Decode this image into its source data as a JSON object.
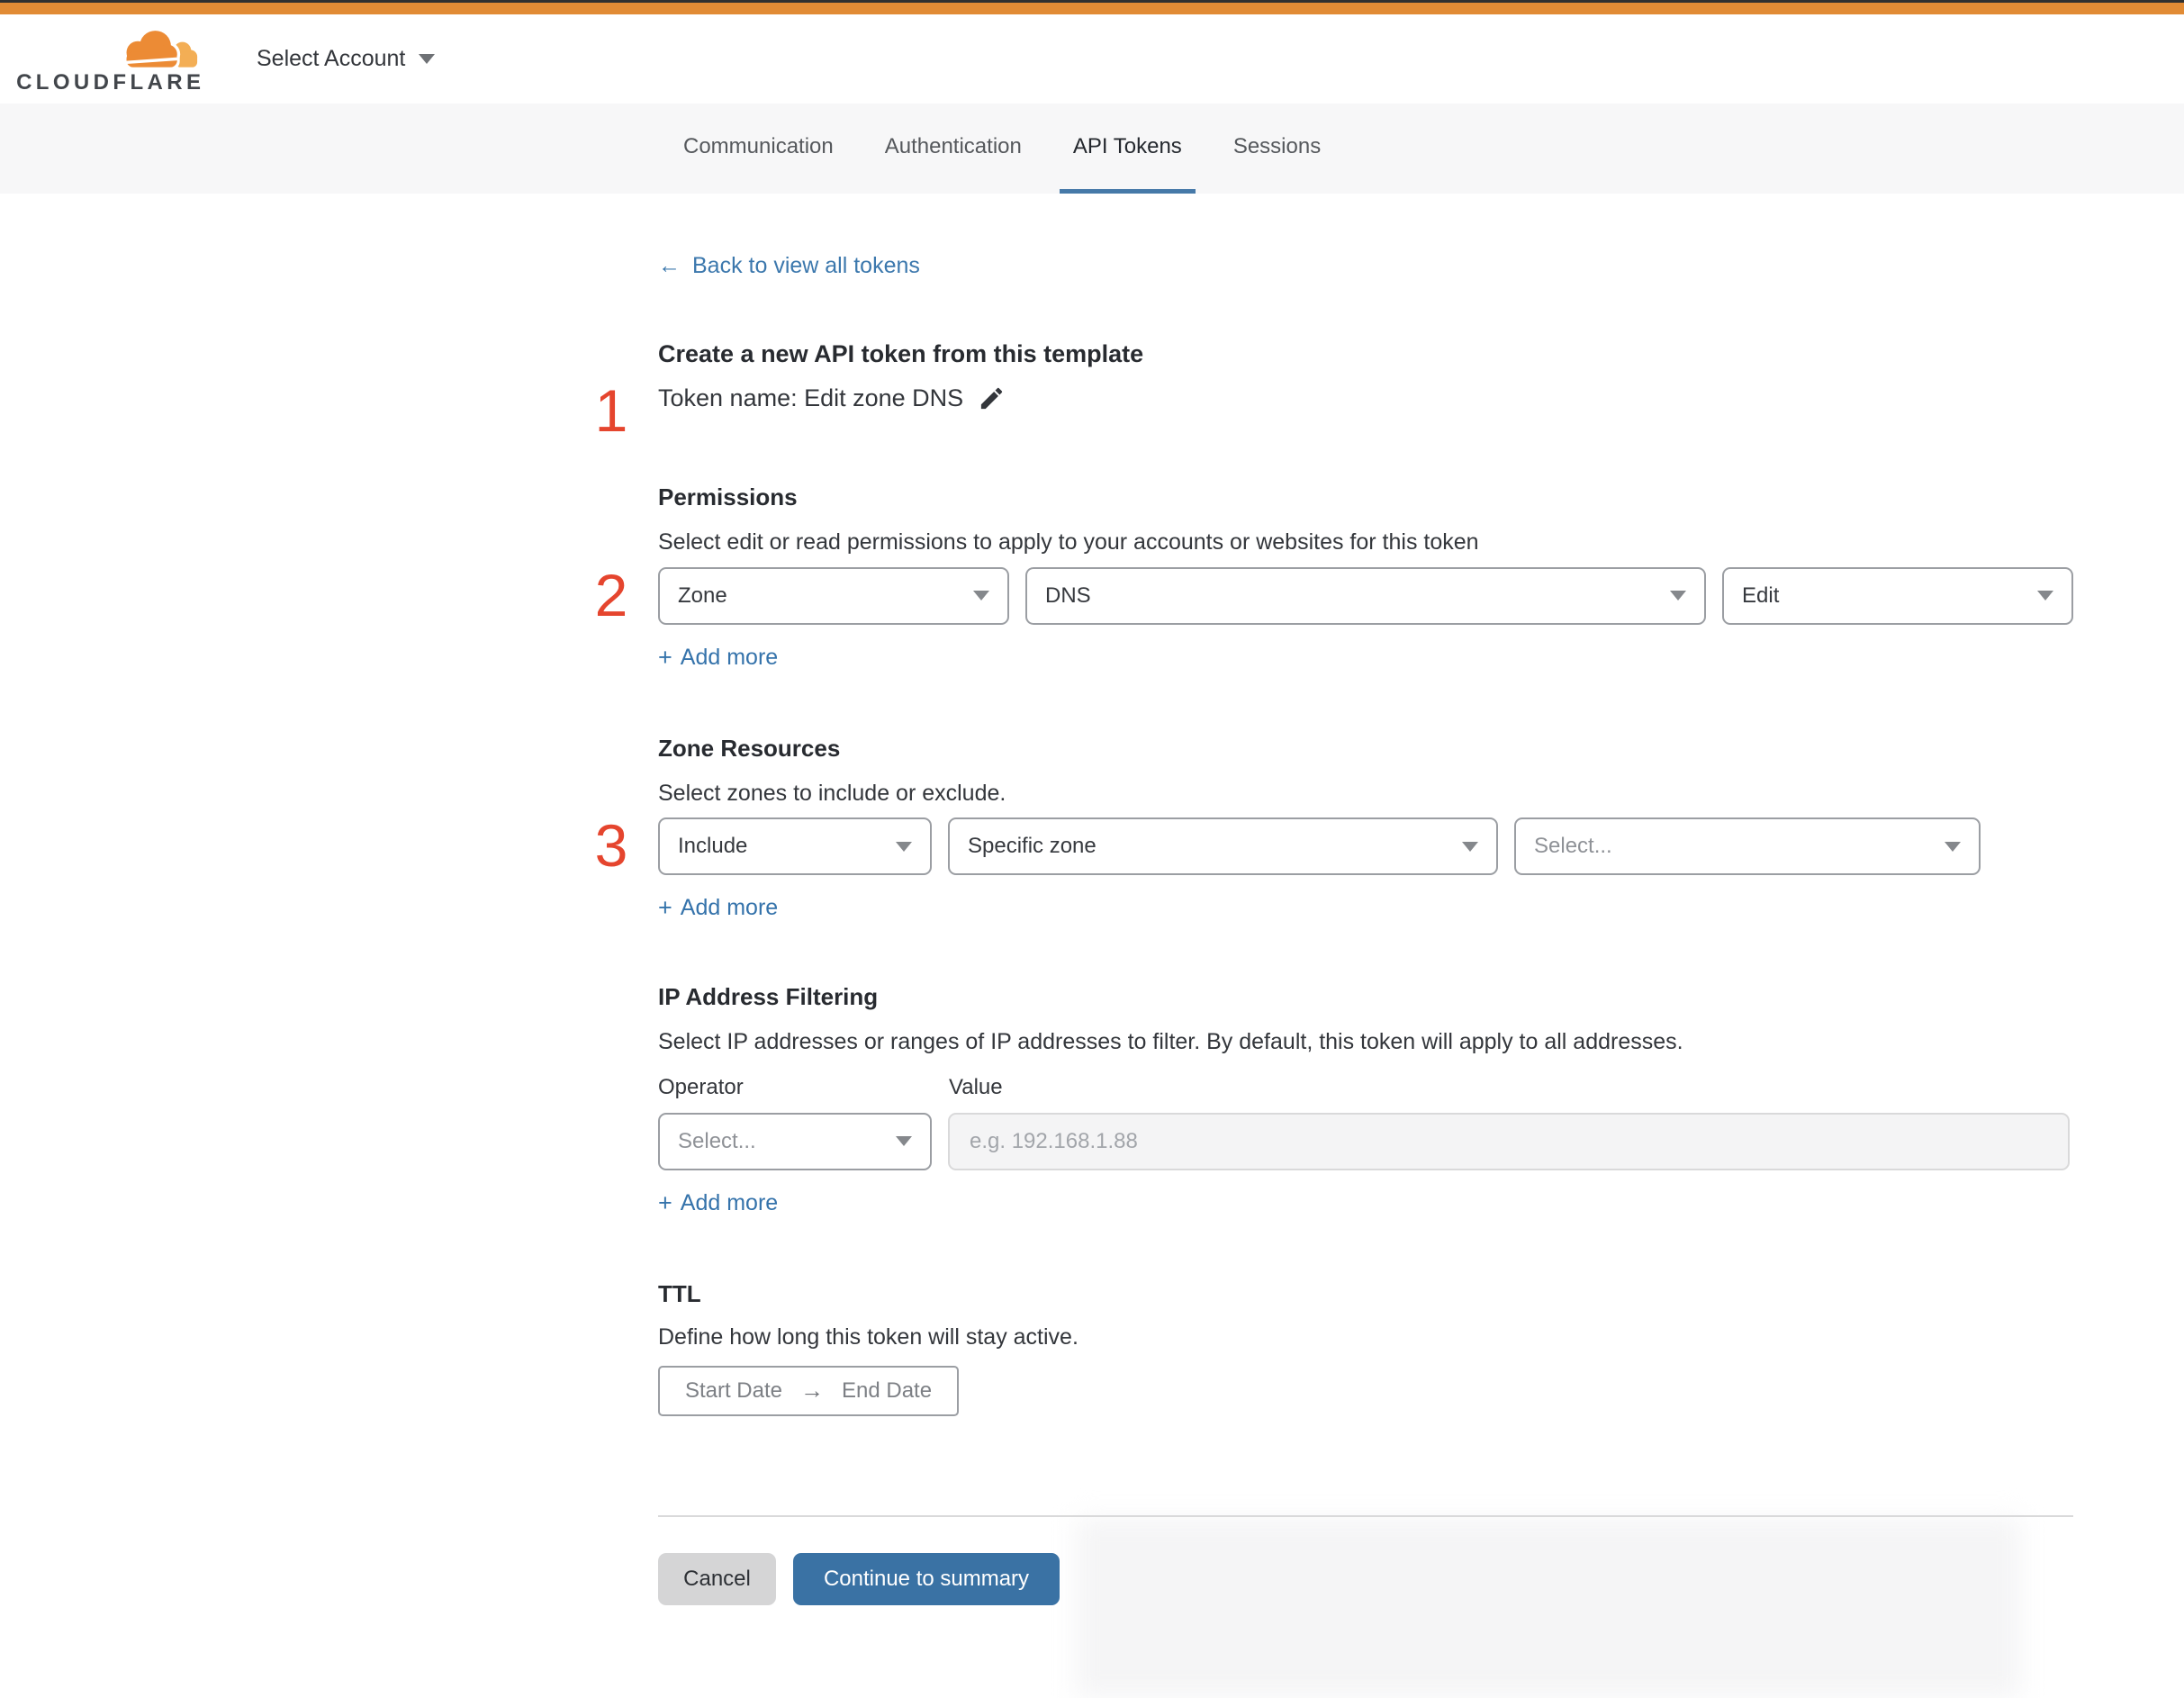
{
  "ui": {
    "plus": "+",
    "add_more": "Add more",
    "back_arrow": "←",
    "arrow_right": "→"
  },
  "header": {
    "logo_text": "CLOUDFLARE",
    "account_selector": "Select Account"
  },
  "tabs": [
    {
      "label": "Communication",
      "active": false
    },
    {
      "label": "Authentication",
      "active": false
    },
    {
      "label": "API Tokens",
      "active": true
    },
    {
      "label": "Sessions",
      "active": false
    }
  ],
  "page": {
    "back_link": "Back to view all tokens",
    "title": "Create a new API token from this template",
    "token_name": "Token name: Edit zone DNS"
  },
  "annotations": {
    "one": "1",
    "two": "2",
    "three": "3"
  },
  "permissions": {
    "title": "Permissions",
    "description": "Select edit or read permissions to apply to your accounts or websites for this token",
    "scope_value": "Zone",
    "resource_value": "DNS",
    "access_value": "Edit"
  },
  "zone_resources": {
    "title": "Zone Resources",
    "description": "Select zones to include or exclude.",
    "mode_value": "Include",
    "type_value": "Specific zone",
    "zone_placeholder": "Select..."
  },
  "ip_filtering": {
    "title": "IP Address Filtering",
    "description": "Select IP addresses or ranges of IP addresses to filter. By default, this token will apply to all addresses.",
    "operator_label": "Operator",
    "value_label": "Value",
    "operator_placeholder": "Select...",
    "value_placeholder": "e.g. 192.168.1.88"
  },
  "ttl": {
    "title": "TTL",
    "description": "Define how long this token will stay active.",
    "start_placeholder": "Start Date",
    "end_placeholder": "End Date"
  },
  "footer": {
    "cancel": "Cancel",
    "continue": "Continue to summary"
  },
  "colors": {
    "accent_orange": "#e18b35",
    "logo_orange": "#ec8b35",
    "logo_light_orange": "#f3ae55",
    "link_blue": "#3c78ad",
    "tab_underline": "#4679a8",
    "button_blue": "#3a72a4",
    "annotation_red": "#e5452e"
  }
}
